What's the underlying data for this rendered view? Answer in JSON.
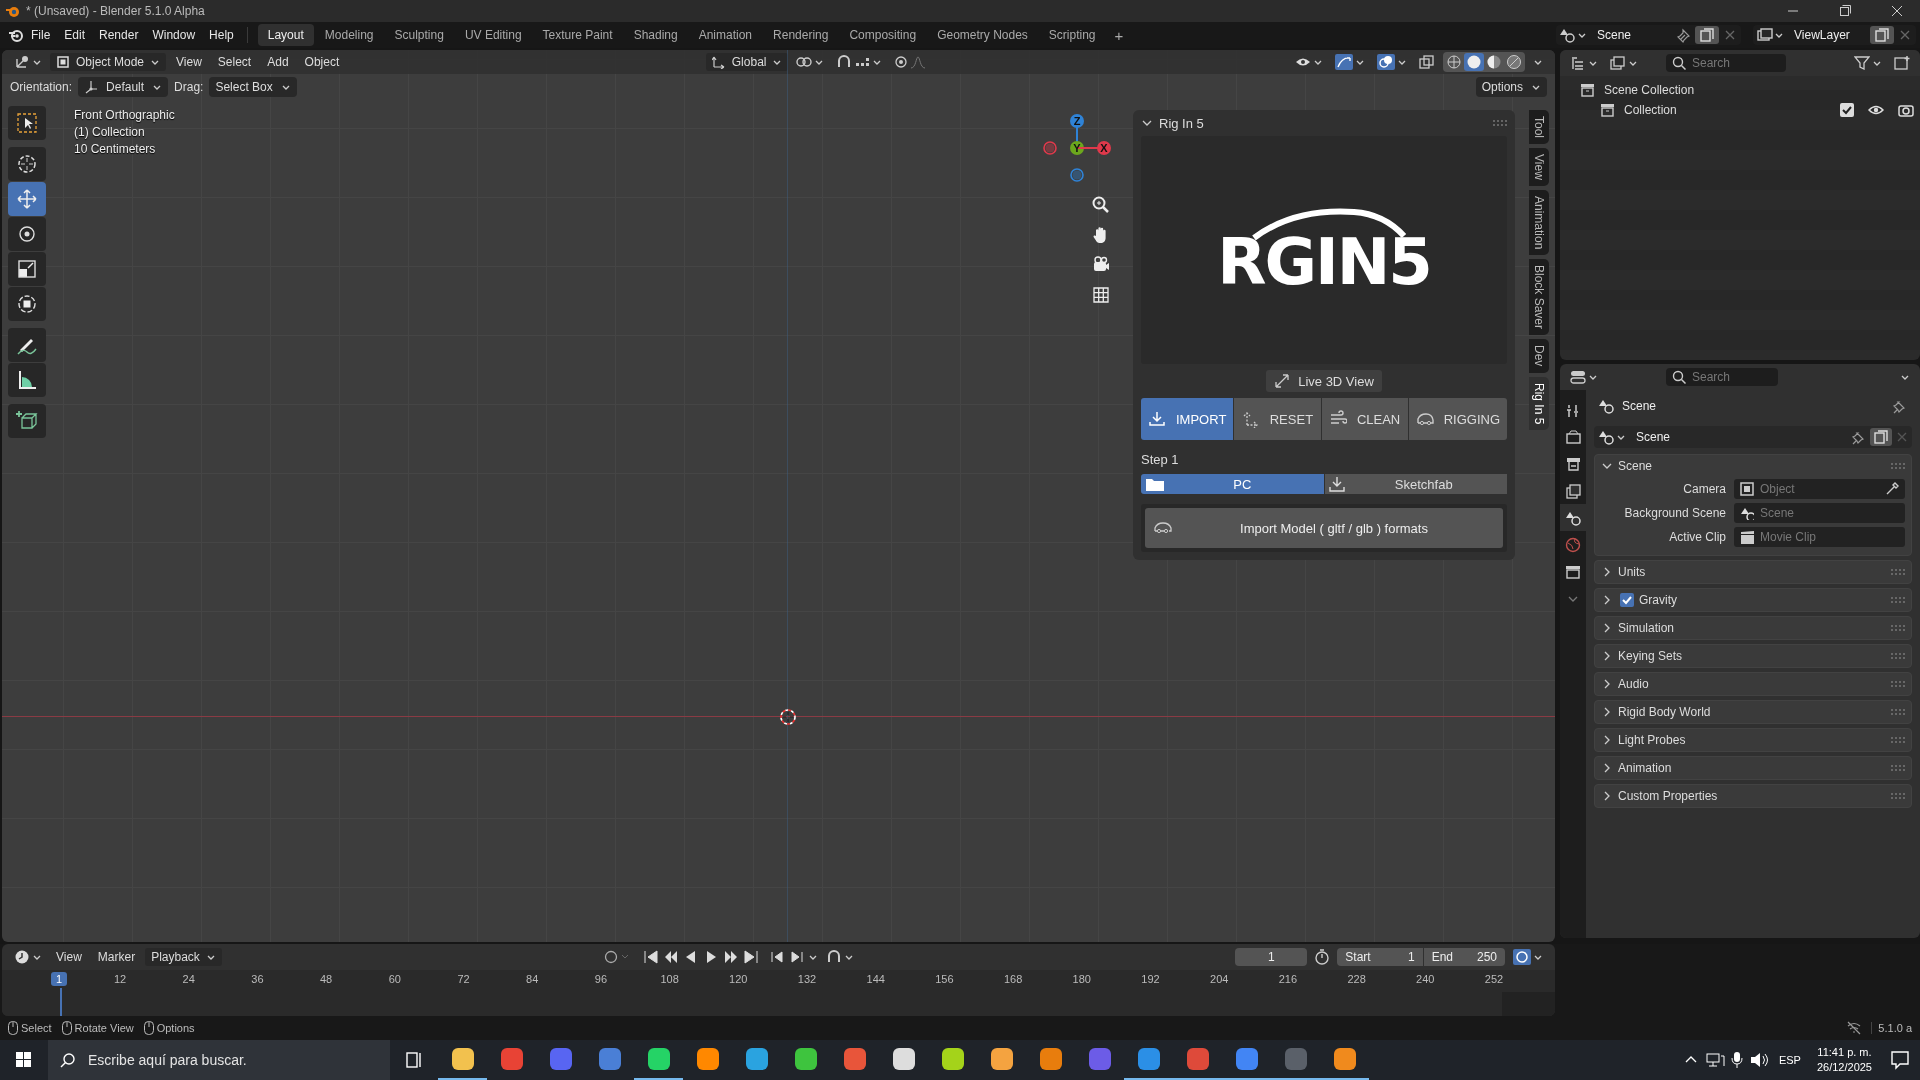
{
  "window": {
    "title": "* (Unsaved) - Blender 5.1.0 Alpha"
  },
  "menu": [
    "File",
    "Edit",
    "Render",
    "Window",
    "Help"
  ],
  "workspaces": [
    {
      "label": "Layout",
      "selected": true
    },
    {
      "label": "Modeling",
      "selected": false
    },
    {
      "label": "Sculpting",
      "selected": false
    },
    {
      "label": "UV Editing",
      "selected": false
    },
    {
      "label": "Texture Paint",
      "selected": false
    },
    {
      "label": "Shading",
      "selected": false
    },
    {
      "label": "Animation",
      "selected": false
    },
    {
      "label": "Rendering",
      "selected": false
    },
    {
      "label": "Compositing",
      "selected": false
    },
    {
      "label": "Geometry Nodes",
      "selected": false
    },
    {
      "label": "Scripting",
      "selected": false
    }
  ],
  "add_workspace": "+",
  "scene_selector": {
    "value": "Scene"
  },
  "view_layer_selector": {
    "value": "ViewLayer"
  },
  "viewport": {
    "mode": "Object Mode",
    "menus": [
      "View",
      "Select",
      "Add",
      "Object"
    ],
    "transform": "Global",
    "shading": [
      {
        "kind": "wireframe",
        "selected": false
      },
      {
        "kind": "solid",
        "selected": true
      },
      {
        "kind": "material",
        "selected": false
      },
      {
        "kind": "rendered",
        "selected": false
      }
    ],
    "orientation_label": "Orientation:",
    "orientation": "Default",
    "drag_label": "Drag:",
    "drag": "Select Box",
    "options": "Options",
    "info": [
      "Front Orthographic",
      "(1) Collection",
      "10 Centimeters"
    ],
    "tools": [
      {
        "kind": "select",
        "selected": false
      },
      {
        "kind": "cursor",
        "selected": false
      },
      {
        "kind": "move",
        "selected": true
      },
      {
        "kind": "rotate",
        "selected": false
      },
      {
        "kind": "scale",
        "selected": false
      },
      {
        "kind": "transform",
        "selected": false
      },
      {
        "kind": "annotate",
        "selected": false
      },
      {
        "kind": "measure",
        "selected": false
      },
      {
        "kind": "add-cube",
        "selected": false
      }
    ],
    "gizmo_axes": [
      {
        "label": "Z",
        "color": "#2f83d7"
      },
      {
        "label": "Y",
        "color": "#6ca71d"
      },
      {
        "label": "X",
        "color": "#e0394b"
      }
    ]
  },
  "sidebar_tabs": [
    {
      "label": "Tool",
      "selected": false
    },
    {
      "label": "View",
      "selected": false
    },
    {
      "label": "Animation",
      "selected": false
    },
    {
      "label": "Block Saver",
      "selected": false
    },
    {
      "label": "Dev",
      "selected": false
    },
    {
      "label": "Rig In 5",
      "selected": true
    }
  ],
  "addon_panel": {
    "title": "Rig In 5",
    "logo": "RGIN5",
    "live_view_button": "Live 3D View",
    "actions": [
      {
        "label": "IMPORT",
        "kind": "import",
        "selected": true
      },
      {
        "label": "RESET",
        "kind": "reset",
        "selected": false
      },
      {
        "label": "CLEAN",
        "kind": "clean",
        "selected": false
      },
      {
        "label": "RIGGING",
        "kind": "rigging",
        "selected": false
      }
    ],
    "step_label": "Step 1",
    "sources": [
      {
        "label": "PC",
        "kind": "folder",
        "selected": true
      },
      {
        "label": "Sketchfab",
        "kind": "download",
        "selected": false
      }
    ],
    "import_button": "Import Model ( gltf / glb ) formats"
  },
  "outliner": {
    "search": {
      "placeholder": "Search"
    },
    "tree": [
      {
        "label": "Scene Collection",
        "children": [
          {
            "label": "Collection",
            "checked": true
          }
        ]
      }
    ]
  },
  "properties": {
    "search": {
      "placeholder": "Search"
    },
    "tabs": [
      {
        "kind": "tool",
        "selected": false
      },
      {
        "kind": "render",
        "selected": false
      },
      {
        "kind": "output",
        "selected": false
      },
      {
        "kind": "view-layer",
        "selected": false
      },
      {
        "kind": "scene",
        "selected": true
      },
      {
        "kind": "world",
        "selected": false
      },
      {
        "kind": "collection",
        "selected": false
      }
    ],
    "title": "Scene",
    "scene_field": "Scene",
    "sections": [
      {
        "label": "Scene",
        "expanded": true,
        "fields": [
          {
            "label": "Camera",
            "placeholder": "Object"
          },
          {
            "label": "Background Scene",
            "placeholder": "Scene"
          },
          {
            "label": "Active Clip",
            "placeholder": "Movie Clip"
          }
        ]
      },
      {
        "label": "Units",
        "expanded": false
      },
      {
        "label": "Gravity",
        "expanded": false,
        "toggle": {
          "checked": true
        }
      },
      {
        "label": "Simulation",
        "expanded": false
      },
      {
        "label": "Keying Sets",
        "expanded": false
      },
      {
        "label": "Audio",
        "expanded": false
      },
      {
        "label": "Rigid Body World",
        "expanded": false
      },
      {
        "label": "Light Probes",
        "expanded": false
      },
      {
        "label": "Animation",
        "expanded": false
      },
      {
        "label": "Custom Properties",
        "expanded": false
      }
    ]
  },
  "timeline": {
    "menus": [
      "View",
      "Marker",
      "Playback"
    ],
    "current_frame": "1",
    "start_label": "Start",
    "start": "1",
    "end_label": "End",
    "end": "250",
    "playhead": "1",
    "ticks": [
      "12",
      "24",
      "36",
      "48",
      "60",
      "72",
      "84",
      "96",
      "108",
      "120",
      "132",
      "144",
      "156",
      "168",
      "180",
      "192",
      "204",
      "216",
      "228",
      "240",
      "252"
    ]
  },
  "status_bar": {
    "hints": [
      "Select",
      "Rotate View",
      "Options"
    ],
    "version": "5.1.0 a"
  },
  "taskbar": {
    "search": {
      "placeholder": "Escribe aquí para buscar."
    },
    "apps": [
      {
        "color": "#f2c14e",
        "running": true
      },
      {
        "color": "#e84335",
        "running": false
      },
      {
        "color": "#5865f2",
        "running": false
      },
      {
        "color": "#4a7fd6",
        "running": false
      },
      {
        "color": "#25d366",
        "running": true
      },
      {
        "color": "#ff8800",
        "running": false
      },
      {
        "color": "#2aa3e0",
        "running": false
      },
      {
        "color": "#3ec43e",
        "running": false
      },
      {
        "color": "#e8553a",
        "running": false
      },
      {
        "color": "#dddddd",
        "running": false
      },
      {
        "color": "#a4d31a",
        "running": false
      },
      {
        "color": "#f4a340",
        "running": false
      },
      {
        "color": "#e87d0d",
        "running": false
      },
      {
        "color": "#6c5ce7",
        "running": false
      },
      {
        "color": "#2b8fe6",
        "running": true
      },
      {
        "color": "#de4a3a",
        "running": true
      },
      {
        "color": "#4285f4",
        "running": true
      },
      {
        "color": "#5a6069",
        "running": true
      },
      {
        "color": "#f08a1d",
        "running": true
      }
    ],
    "language": "ESP",
    "time": "11:41 p. m.",
    "date": "26/12/2025"
  }
}
